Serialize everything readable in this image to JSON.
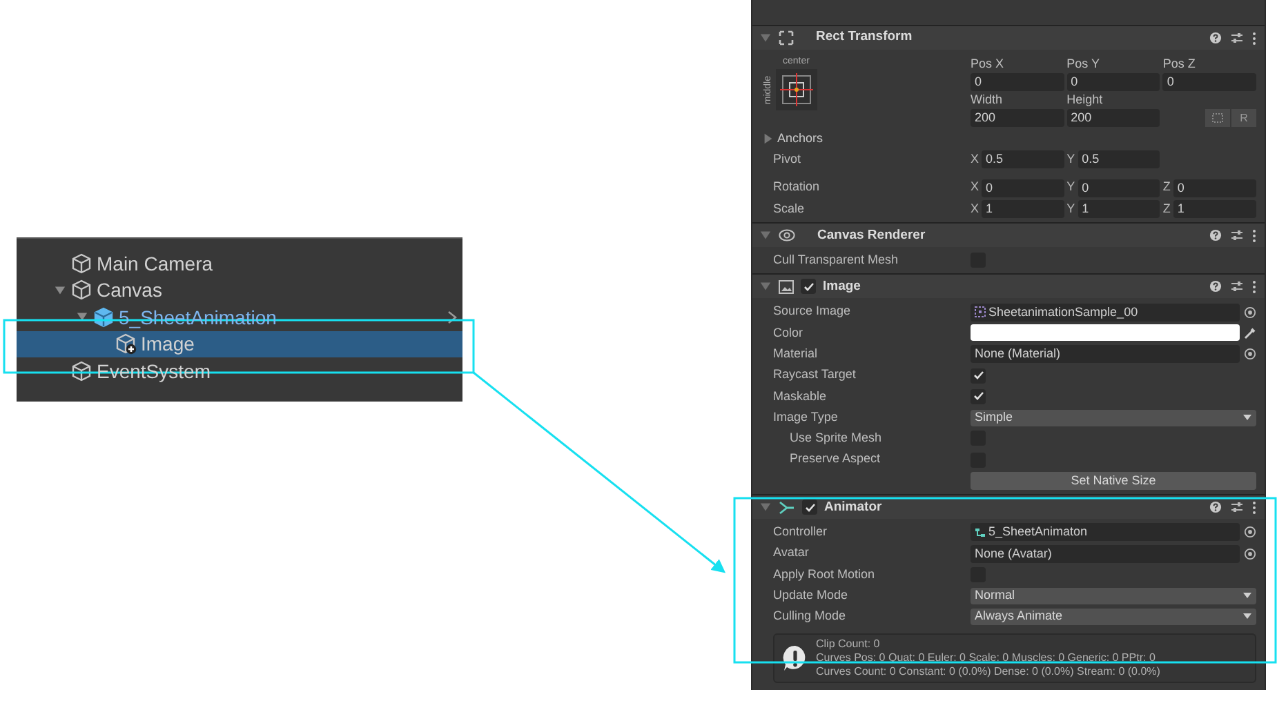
{
  "hierarchy": {
    "items": [
      {
        "name": "Main Camera",
        "kind": "object",
        "selected": false
      },
      {
        "name": "Canvas",
        "kind": "object",
        "selected": false,
        "expanded": true,
        "children": [
          {
            "name": "5_SheetAnimation",
            "kind": "prefab",
            "selected": false,
            "expanded": true,
            "children": [
              {
                "name": "Image",
                "kind": "added",
                "selected": true
              }
            ]
          }
        ]
      },
      {
        "name": "EventSystem",
        "kind": "object",
        "selected": false
      }
    ]
  },
  "inspector": {
    "rect_transform": {
      "title": "Rect Transform",
      "expanded": true,
      "anchor_h": "center",
      "anchor_v": "middle",
      "pos_headers": [
        "Pos X",
        "Pos Y",
        "Pos Z"
      ],
      "pos_values": [
        "0",
        "0",
        "0"
      ],
      "size_headers": [
        "Width",
        "Height"
      ],
      "size_values": [
        "200",
        "200"
      ],
      "raw_button": "R",
      "rows": [
        {
          "kind": "foldout",
          "label": "Anchors"
        },
        {
          "kind": "vector",
          "label": "Pivot",
          "fields": [
            {
              "axis": "X",
              "value": "0.5"
            },
            {
              "axis": "Y",
              "value": "0.5"
            }
          ]
        },
        {
          "kind": "vector",
          "label": "Rotation",
          "fields": [
            {
              "axis": "X",
              "value": "0"
            },
            {
              "axis": "Y",
              "value": "0"
            },
            {
              "axis": "Z",
              "value": "0"
            }
          ]
        },
        {
          "kind": "vector",
          "label": "Scale",
          "fields": [
            {
              "axis": "X",
              "value": "1"
            },
            {
              "axis": "Y",
              "value": "1"
            },
            {
              "axis": "Z",
              "value": "1"
            }
          ]
        }
      ]
    },
    "components": [
      {
        "title": "Canvas Renderer",
        "kind": "eye",
        "expanded": true,
        "rows": [
          {
            "kind": "checkbox",
            "label": "Cull Transparent Mesh",
            "checked": false
          }
        ]
      },
      {
        "title": "Image",
        "kind": "image",
        "expanded": true,
        "enabled": true,
        "rows": [
          {
            "kind": "sprite",
            "label": "Source Image",
            "value": "SheetanimationSample_00"
          },
          {
            "kind": "color",
            "label": "Color",
            "color": "#ffffff"
          },
          {
            "kind": "object",
            "label": "Material",
            "value": "None (Material)"
          },
          {
            "kind": "checkbox",
            "label": "Raycast Target",
            "checked": true
          },
          {
            "kind": "checkbox",
            "label": "Maskable",
            "checked": true
          },
          {
            "kind": "dropdown",
            "label": "Image Type",
            "value": "Simple"
          },
          {
            "kind": "checkbox",
            "label": "Use Sprite Mesh",
            "checked": false,
            "indent": true
          },
          {
            "kind": "checkbox",
            "label": "Preserve Aspect",
            "checked": false,
            "indent": true
          },
          {
            "kind": "button",
            "label": "Set Native Size"
          }
        ]
      },
      {
        "title": "Animator",
        "kind": "animator",
        "expanded": true,
        "enabled": true,
        "rows": [
          {
            "kind": "controller",
            "label": "Controller",
            "value": "5_SheetAnimaton"
          },
          {
            "kind": "object",
            "label": "Avatar",
            "value": "None (Avatar)"
          },
          {
            "kind": "checkbox",
            "label": "Apply Root Motion",
            "checked": false
          },
          {
            "kind": "dropdown",
            "label": "Update Mode",
            "value": "Normal"
          },
          {
            "kind": "dropdown",
            "label": "Culling Mode",
            "value": "Always Animate"
          },
          {
            "kind": "info",
            "lines": [
              "Clip Count: 0",
              "Curves Pos: 0 Quat: 0 Euler: 0 Scale: 0 Muscles: 0 Generic: 0 PPtr: 0",
              "Curves Count: 0 Constant: 0 (0.0%) Dense: 0 (0.0%) Stream: 0 (0.0%)"
            ]
          }
        ]
      }
    ]
  }
}
